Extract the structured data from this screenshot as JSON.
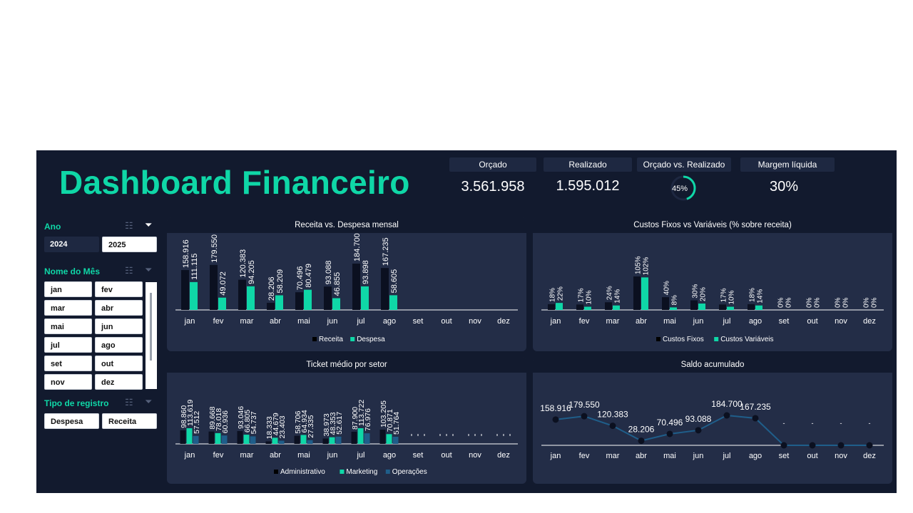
{
  "header": {
    "title": "Dashboard Financeiro"
  },
  "kpis": {
    "orcado": {
      "label": "Orçado",
      "value": "3.561.958"
    },
    "realizado": {
      "label": "Realizado",
      "value": "1.595.012"
    },
    "orcado_vs_realizado": {
      "label": "Orçado vs. Realizado",
      "value": "45%",
      "fraction": 0.45
    },
    "margem": {
      "label": "Margem líquida",
      "value": "30%"
    }
  },
  "slicers": {
    "ano": {
      "title": "Ano",
      "items": [
        "2024",
        "2025"
      ],
      "selected": [
        "2025"
      ]
    },
    "mes": {
      "title": "Nome do Mês",
      "items": [
        "jan",
        "fev",
        "mar",
        "abr",
        "mai",
        "jun",
        "jul",
        "ago",
        "set",
        "out",
        "nov",
        "dez"
      ]
    },
    "tipo": {
      "title": "Tipo de registro",
      "items": [
        "Despesa",
        "Receita"
      ]
    }
  },
  "colors": {
    "accent": "#0fd7a7",
    "dark_series": "#0b1020",
    "third_series": "#1f5e8a",
    "panel": "#232d47",
    "background": "#121a2e"
  },
  "chart_data": [
    {
      "id": "receita-despesa",
      "type": "bar",
      "title": "Receita vs. Despesa mensal",
      "categories": [
        "jan",
        "fev",
        "mar",
        "abr",
        "mai",
        "jun",
        "jul",
        "ago",
        "set",
        "out",
        "nov",
        "dez"
      ],
      "series": [
        {
          "name": "Receita",
          "color": "#0b1020",
          "values": [
            158916,
            179550,
            120383,
            28206,
            70496,
            93088,
            184700,
            167235,
            null,
            null,
            null,
            null
          ],
          "labels": [
            "158.916",
            "179.550",
            "120.383",
            "28.206",
            "70.496",
            "93.088",
            "184.700",
            "167.235"
          ]
        },
        {
          "name": "Despesa",
          "color": "#0fd7a7",
          "values": [
            111115,
            49072,
            94205,
            58209,
            80479,
            46855,
            93898,
            58605,
            null,
            null,
            null,
            null
          ],
          "labels": [
            "111.115",
            "49.072",
            "94.205",
            "58.209",
            "80.479",
            "46.855",
            "93.898",
            "58.605"
          ]
        }
      ],
      "legend": "bottom"
    },
    {
      "id": "custos",
      "type": "bar",
      "title": "Custos Fixos vs Variáveis (% sobre receita)",
      "categories": [
        "jan",
        "fev",
        "mar",
        "abr",
        "mai",
        "jun",
        "jul",
        "ago",
        "set",
        "out",
        "nov",
        "dez"
      ],
      "series": [
        {
          "name": "Custos Fixos",
          "color": "#0b1020",
          "values": [
            18,
            17,
            24,
            105,
            40,
            30,
            17,
            18,
            0,
            0,
            0,
            0
          ],
          "labels": [
            "18%",
            "17%",
            "24%",
            "105%",
            "40%",
            "30%",
            "17%",
            "18%",
            "0%",
            "0%",
            "0%",
            "0%"
          ]
        },
        {
          "name": "Custos Variáveis",
          "color": "#0fd7a7",
          "values": [
            22,
            10,
            14,
            102,
            8,
            20,
            10,
            14,
            0,
            0,
            0,
            0
          ],
          "labels": [
            "22%",
            "10%",
            "14%",
            "102%",
            "8%",
            "20%",
            "10%",
            "14%",
            "0%",
            "0%",
            "0%",
            "0%"
          ]
        }
      ],
      "legend": "bottom"
    },
    {
      "id": "ticket",
      "type": "bar",
      "title": "Ticket médio por setor",
      "categories": [
        "jan",
        "fev",
        "mar",
        "abr",
        "mai",
        "jun",
        "jul",
        "ago",
        "set",
        "out",
        "nov",
        "dez"
      ],
      "series": [
        {
          "name": "Administrativo",
          "color": "#0b1020",
          "values": [
            98860,
            89668,
            93046,
            18333,
            58706,
            38973,
            87900,
            103205,
            null,
            null,
            null,
            null
          ],
          "labels": [
            "98.860",
            "89.668",
            "93.046",
            "18.333",
            "58.706",
            "38.973",
            "87.900",
            "103.205"
          ]
        },
        {
          "name": "Marketing",
          "color": "#0fd7a7",
          "values": [
            113619,
            78018,
            66805,
            44679,
            64934,
            48353,
            113722,
            70871,
            null,
            null,
            null,
            null
          ],
          "labels": [
            "113.619",
            "78.018",
            "66.805",
            "44.679",
            "64.934",
            "48.353",
            "113.722",
            "70.871"
          ]
        },
        {
          "name": "Operações",
          "color": "#1f5e8a",
          "values": [
            57512,
            60936,
            54737,
            23403,
            27335,
            52617,
            76976,
            51764,
            null,
            null,
            null,
            null
          ],
          "labels": [
            "57.512",
            "60.936",
            "54.737",
            "23.403",
            "27.335",
            "52.617",
            "76.976",
            "51.764"
          ]
        }
      ],
      "legend": "bottom"
    },
    {
      "id": "saldo",
      "type": "line",
      "title": "Saldo acumulado",
      "categories": [
        "jan",
        "fev",
        "mar",
        "abr",
        "mai",
        "jun",
        "jul",
        "ago",
        "set",
        "out",
        "nov",
        "dez"
      ],
      "values": [
        158916,
        179550,
        120383,
        28206,
        70496,
        93088,
        184700,
        167235,
        0,
        0,
        0,
        0
      ],
      "labels": [
        "158.916",
        "179.550",
        "120.383",
        "28.206",
        "70.496",
        "93.088",
        "184.700",
        "167.235",
        "-",
        "-",
        "-",
        "-"
      ]
    }
  ]
}
